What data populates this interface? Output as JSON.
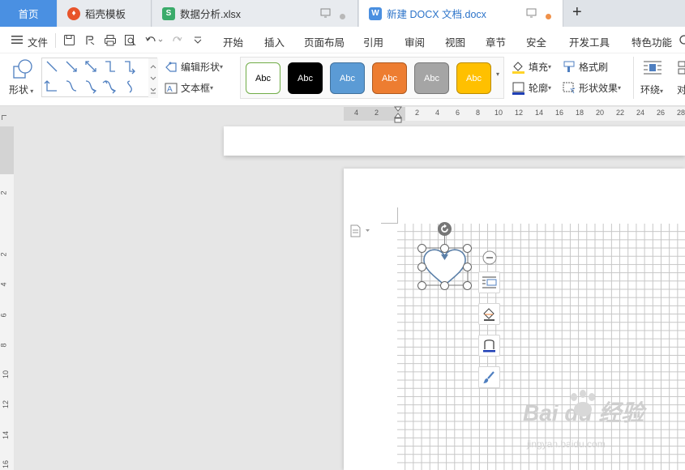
{
  "tabs": {
    "home": "首页",
    "template": "稻壳模板",
    "spreadsheet": "数据分析.xlsx",
    "document": "新建 DOCX 文档.docx",
    "spreadsheet_icon_letter": "S",
    "document_icon_letter": "W"
  },
  "menu": {
    "file": "文件",
    "items": [
      "开始",
      "插入",
      "页面布局",
      "引用",
      "审阅",
      "视图",
      "章节",
      "安全",
      "开发工具",
      "特色功能"
    ]
  },
  "ribbon": {
    "shape_label": "形状",
    "edit_shape": "编辑形状",
    "text_box": "文本框",
    "style_samples": [
      "Abc",
      "Abc",
      "Abc",
      "Abc",
      "Abc",
      "Abc"
    ],
    "fill": "填充",
    "outline": "轮廓",
    "format_painter": "格式刷",
    "shape_effects": "形状效果",
    "wrap": "环绕",
    "align_partial": "对"
  },
  "ruler": {
    "horizontal": [
      "4",
      "2",
      "2",
      "4",
      "6",
      "8",
      "10",
      "12",
      "14",
      "16",
      "18",
      "20",
      "22",
      "24",
      "26",
      "28"
    ],
    "vertical": [
      "2",
      "2",
      "4",
      "6",
      "8",
      "10",
      "12",
      "14",
      "16"
    ]
  },
  "watermark": {
    "brand": "Bai du 经验",
    "url": "jingyan.baidu.com"
  },
  "colors": {
    "tab_home_bg": "#4a90e2",
    "style_white": "#ffffff",
    "style_black": "#000000",
    "style_blue": "#5b9bd5",
    "style_orange": "#ed7d31",
    "style_gray": "#a5a5a5",
    "style_yellow": "#ffc000",
    "heart_stroke": "#5a7fa8"
  }
}
